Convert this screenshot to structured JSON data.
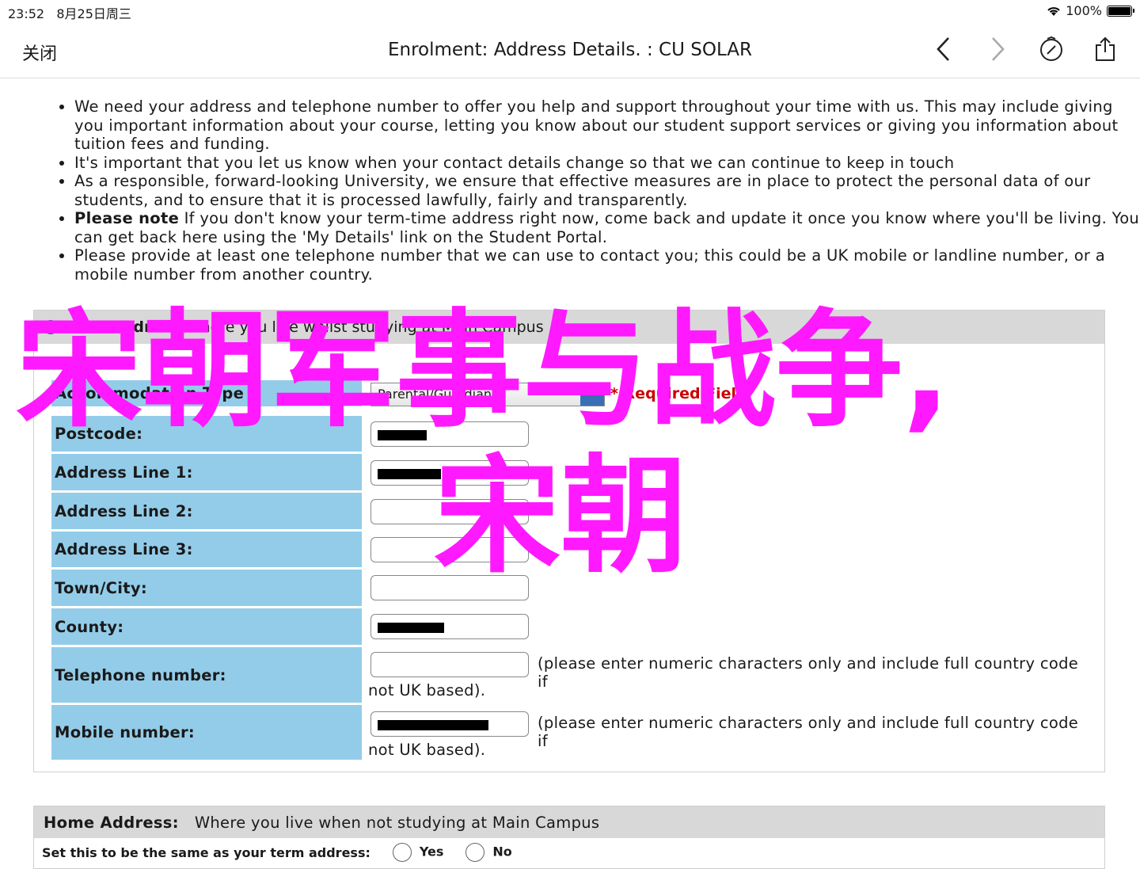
{
  "status": {
    "time": "23:52",
    "date": "8月25日周三",
    "battery": "100%"
  },
  "nav": {
    "close": "关闭",
    "title": "Enrolment: Address Details. : CU SOLAR"
  },
  "info": [
    "We need your address and telephone number to offer you help and support throughout your time with us. This may include giving you important information about your course, letting you know about our student support services or giving you information about tuition fees and funding.",
    "It's important that you let us know when your contact details change so that we can continue to keep in touch",
    "As a responsible, forward-looking University, we ensure that effective measures are in place to protect the personal data of our students, and to ensure that it is processed lawfully, fairly and transparently.",
    {
      "bold": "Please note",
      "text": " If you don't know your term-time address right now, come back and update it once you know where you'll be living. You can get back here using the 'My Details' link on the Student Portal."
    },
    "Please provide at least one telephone number that we can use to contact you; this could be a UK mobile or landline number, or a mobile number from another country."
  ],
  "term_address": {
    "title": "Term Address",
    "subtitle": "Where you live whilst studying at Main Campus",
    "accommodation_label": "Accommodation Type",
    "accommodation_value": "Parental/Guardian",
    "required": "* Required Field",
    "fields": {
      "postcode": "Postcode:",
      "line1": "Address Line 1:",
      "line2": "Address Line 2:",
      "line3": "Address Line 3:",
      "town": "Town/City:",
      "county": "County:",
      "telephone": "Telephone number:",
      "mobile": "Mobile number:"
    },
    "hint_a": "(please enter numeric characters only and include full country code if",
    "hint_b": "not UK based)."
  },
  "home_address": {
    "title": "Home Address:",
    "subtitle": "Where you live when not studying at Main Campus",
    "same_label": "Set this to be the same as your term address:",
    "yes": "Yes",
    "no": "No"
  },
  "watermark": {
    "line1": "宋朝军事与战争,",
    "line2": "宋朝"
  },
  "colors": {
    "label_bg": "#93cce9",
    "watermark": "#ff19ff",
    "header_bg": "#d8d8d8"
  }
}
